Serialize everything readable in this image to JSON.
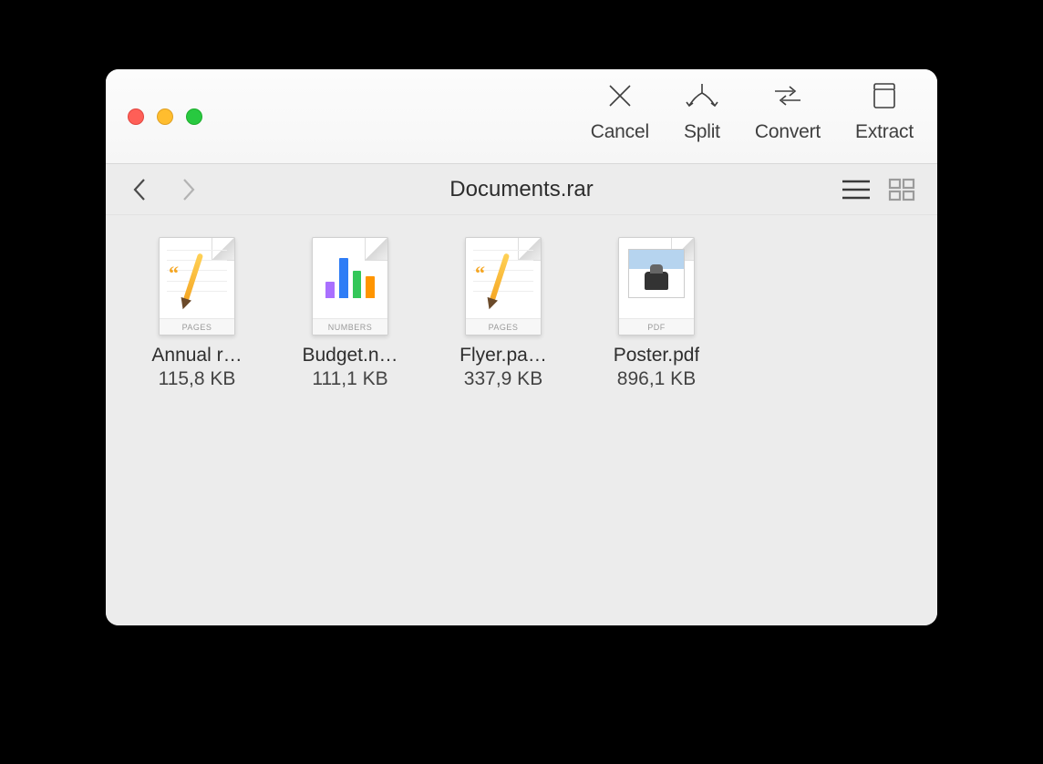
{
  "toolbar": {
    "cancel_label": "Cancel",
    "split_label": "Split",
    "convert_label": "Convert",
    "extract_label": "Extract"
  },
  "nav": {
    "title": "Documents.rar",
    "back_enabled": true,
    "forward_enabled": false,
    "view_list_active": true,
    "view_grid_active": false
  },
  "files": [
    {
      "name": "Annual r…",
      "size": "115,8 KB",
      "type_label": "PAGES",
      "kind": "pages"
    },
    {
      "name": "Budget.n…",
      "size": "111,1 KB",
      "type_label": "NUMBERS",
      "kind": "numbers"
    },
    {
      "name": "Flyer.pa…",
      "size": "337,9 KB",
      "type_label": "PAGES",
      "kind": "pages"
    },
    {
      "name": "Poster.pdf",
      "size": "896,1 KB",
      "type_label": "PDF",
      "kind": "pdf"
    }
  ]
}
